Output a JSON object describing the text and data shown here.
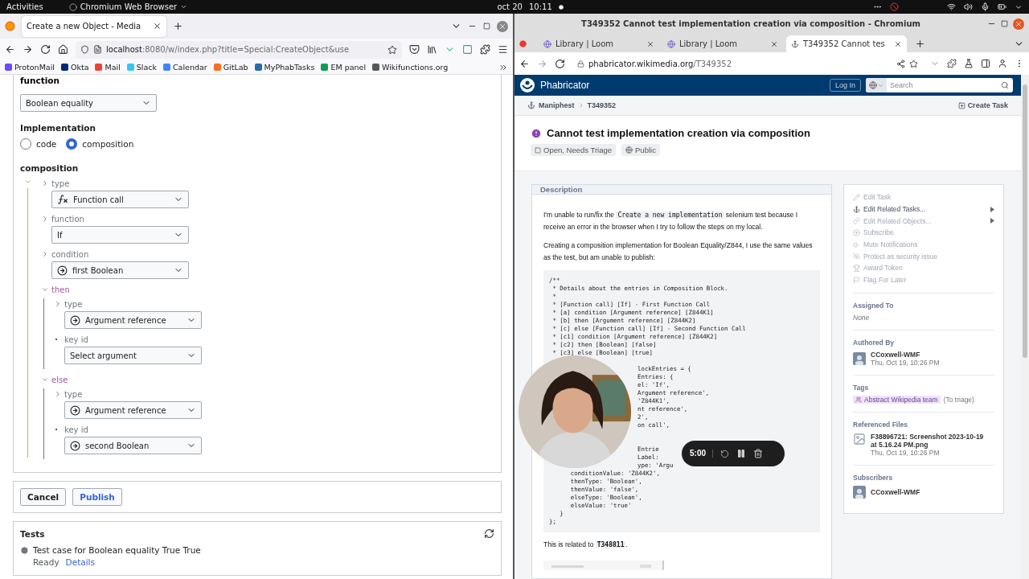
{
  "top_bar": {
    "activities": "Activities",
    "app": "Chromium Web Browser",
    "date": "oct 20",
    "time": "10:11"
  },
  "left_browser": {
    "tabs": [
      {
        "title": "Create a new Object - Media",
        "selected": true
      }
    ],
    "url": {
      "host": "localhost",
      "path": ":8080/w/index.php?title=Special:CreateObject&use"
    },
    "bookmarks": [
      {
        "label": "ProtonMail",
        "color": "#6d4aff"
      },
      {
        "label": "Okta",
        "color": "#00297a"
      },
      {
        "label": "Mail",
        "color": "#ea4335"
      },
      {
        "label": "Slack",
        "color": "#36c5f0"
      },
      {
        "label": "Calendar",
        "color": "#4285f4"
      },
      {
        "label": "GitLab",
        "color": "#fc6d26"
      },
      {
        "label": "MyPhabTasks",
        "color": "#2b6cb0"
      },
      {
        "label": "EM panel",
        "color": "#0f9d58"
      },
      {
        "label": "Wikifunctions.org",
        "color": "#54595d"
      }
    ],
    "form": {
      "function_label": "function",
      "function_value": "Boolean equality",
      "implementation_title": "Implementation",
      "implementation_options": [
        {
          "label": "code",
          "selected": false
        },
        {
          "label": "composition",
          "selected": true
        }
      ],
      "composition_title": "composition",
      "composition_expanded": true,
      "entries": [
        {
          "label": "type",
          "kind": "toggle",
          "expanded": false,
          "select": {
            "value": "Function call",
            "kind": "function_call"
          }
        },
        {
          "label": "function",
          "kind": "toggle",
          "expanded": false,
          "select": {
            "value": "If",
            "kind": "plain"
          }
        },
        {
          "label": "condition",
          "kind": "toggle",
          "expanded": false,
          "select": {
            "value": "first Boolean",
            "kind": "argument"
          }
        },
        {
          "label": "then",
          "kind": "toggle",
          "expanded": true,
          "children": [
            {
              "label": "type",
              "kind": "toggle",
              "expanded": false,
              "select": {
                "value": "Argument reference",
                "kind": "argument"
              }
            },
            {
              "label": "key id",
              "kind": "bullet",
              "select": {
                "value": "Select argument",
                "kind": "plain"
              }
            }
          ]
        },
        {
          "label": "else",
          "kind": "toggle",
          "expanded": true,
          "children": [
            {
              "label": "type",
              "kind": "toggle",
              "expanded": false,
              "select": {
                "value": "Argument reference",
                "kind": "argument"
              }
            },
            {
              "label": "key id",
              "kind": "bullet",
              "select": {
                "value": "second Boolean",
                "kind": "argument"
              }
            }
          ]
        }
      ],
      "buttons": [
        {
          "label": "Cancel",
          "kind": "neutral"
        },
        {
          "label": "Publish",
          "kind": "progressive"
        }
      ],
      "tests": {
        "title": "Tests",
        "items": [
          {
            "name": "Test case for Boolean equality True True",
            "status": "Ready",
            "link": "Details"
          }
        ]
      }
    }
  },
  "right_browser": {
    "window_title": "T349352 Cannot test implementation creation via composition - Chromium",
    "tabs": [
      {
        "title": "Library | Loom",
        "selected": false
      },
      {
        "title": "Library | Loom",
        "selected": false
      },
      {
        "title": "T349352 Cannot tes",
        "selected": true
      }
    ],
    "url": {
      "host": "phabricator.wikimedia.org",
      "path": "/T349352"
    },
    "phabricator": {
      "app_name": "Phabricator",
      "login": "Log In",
      "search_placeholder": "Search",
      "breadcrumbs": [
        "Maniphest",
        "T349352"
      ],
      "create_task": "Create Task",
      "task_title": "Cannot test implementation creation via composition",
      "status": "Open, Needs Triage",
      "policy": "Public",
      "description_title": "Description",
      "paragraphs": [
        [
          {
            "kind": "text",
            "text": "I'm unable to run/fix the "
          },
          {
            "kind": "code",
            "text": "Create a new implementation"
          },
          {
            "kind": "text",
            "text": " selenium test because I receive an error in the browser when I try to follow the steps on my local."
          }
        ],
        [
          {
            "kind": "text",
            "text": "Creating a composition implementation for Boolean Equality/Z844, I use the same values as the test, but am unable to publish:"
          }
        ]
      ],
      "code_lines": [
        {
          "kind": "full",
          "text": "/**"
        },
        {
          "kind": "full",
          "text": " * Details about the entries in Composition Block."
        },
        {
          "kind": "full",
          "text": " *"
        },
        {
          "kind": "full",
          "text": " * [Function call] [If] - First Function Call"
        },
        {
          "kind": "full",
          "text": " * [a] condition [Argument reference] [Z844K1]"
        },
        {
          "kind": "full",
          "text": " * [b] then [Argument reference] [Z844K2]"
        },
        {
          "kind": "full",
          "text": " * [c] else [Function call] [If] - Second Function Call"
        },
        {
          "kind": "full",
          "text": " * [c1] condition [Argument reference] [Z844K2]"
        },
        {
          "kind": "full",
          "text": " * [c2] then [Boolean] [false]"
        },
        {
          "kind": "full",
          "text": " * [c3] else [Boolean] [true]"
        },
        {
          "kind": "hidden"
        },
        {
          "kind": "clipped",
          "text": "lockEntries = {"
        },
        {
          "kind": "clipped",
          "text": "Entries: {"
        },
        {
          "kind": "clipped",
          "text": "el: 'If',"
        },
        {
          "kind": "clipped",
          "text": "Argument reference',"
        },
        {
          "kind": "clipped",
          "text": "'Z844K1',"
        },
        {
          "kind": "clipped",
          "text": "nt reference',"
        },
        {
          "kind": "clipped",
          "text": "2',"
        },
        {
          "kind": "clipped",
          "text": "on call',"
        },
        {
          "kind": "hidden"
        },
        {
          "kind": "hidden"
        },
        {
          "kind": "clipped",
          "text": "Entrie"
        },
        {
          "kind": "clipped",
          "text": "Label:"
        },
        {
          "kind": "clipped",
          "text": "ype: 'Argu"
        },
        {
          "kind": "full",
          "text": "      conditionValue: 'Z844K2',"
        },
        {
          "kind": "full",
          "text": "      thenType: 'Boolean',"
        },
        {
          "kind": "full",
          "text": "      thenValue: 'false',"
        },
        {
          "kind": "full",
          "text": "      elseType: 'Boolean',"
        },
        {
          "kind": "full",
          "text": "      elseValue: 'true'"
        },
        {
          "kind": "full",
          "text": "   }"
        },
        {
          "kind": "full",
          "text": "};"
        }
      ],
      "related_prefix": "This is related to ",
      "related_task": "T348811",
      "related_suffix": ".",
      "thumbnail": {
        "kind": "picture"
      },
      "actions": [
        {
          "label": "Edit Task",
          "disabled": true,
          "submenu": false
        },
        {
          "label": "Edit Related Tasks...",
          "disabled": false,
          "submenu": true
        },
        {
          "label": "Edit Related Objects...",
          "disabled": true,
          "submenu": true
        },
        {
          "label": "Subscribe",
          "disabled": true,
          "submenu": false
        },
        {
          "label": "Mute Notifications",
          "disabled": true,
          "submenu": false
        },
        {
          "label": "Protect as security issue",
          "disabled": true,
          "submenu": false
        },
        {
          "label": "Award Token",
          "disabled": true,
          "submenu": false
        },
        {
          "label": "Flag For Later",
          "disabled": true,
          "submenu": false
        }
      ],
      "sections": [
        {
          "kind": "text",
          "title": "Assigned To",
          "value": "None"
        },
        {
          "kind": "user",
          "title": "Authored By",
          "name": "CCoxwell-WMF",
          "date": "Thu, Oct 19, 10:26 PM"
        },
        {
          "kind": "tag",
          "title": "Tags",
          "tag": "Abstract Wikipedia team",
          "note": "(To triage)"
        },
        {
          "kind": "file",
          "title": "Referenced Files",
          "name": "F38896721: Screenshot 2023-10-19 at 5.16.24 PM.png",
          "date": "Thu, Oct 19, 10:26 PM"
        },
        {
          "kind": "user",
          "title": "Subscribers",
          "name": "CCoxwell-WMF"
        }
      ]
    }
  },
  "recorder": {
    "time": "5:00"
  }
}
